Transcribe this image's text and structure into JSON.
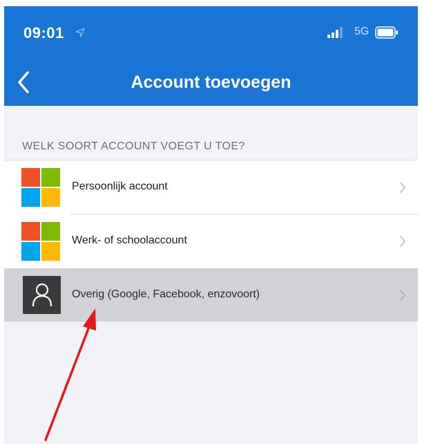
{
  "status_bar": {
    "time": "09:01",
    "network": "5G",
    "location_icon": "location-arrow-icon",
    "signal_icon": "signal-bars-icon",
    "battery_icon": "battery-icon"
  },
  "nav": {
    "title": "Account toevoegen",
    "back_icon": "chevron-left-icon"
  },
  "section_header": "WELK SOORT ACCOUNT VOEGT U TOE?",
  "accounts": [
    {
      "label": "Persoonlijk account",
      "icon": "microsoft-logo-icon",
      "selected": false
    },
    {
      "label": "Werk- of schoolaccount",
      "icon": "microsoft-logo-icon",
      "selected": false
    },
    {
      "label": "Overig (Google, Facebook, enzovoort)",
      "icon": "person-icon",
      "selected": true
    }
  ],
  "colors": {
    "brand_blue": "#1a74d6",
    "selected_row": "#d1d1d6",
    "background": "#f2f2f7",
    "annotation_arrow": "#e3191b",
    "ms_red": "#f25022",
    "ms_green": "#7fba00",
    "ms_blue": "#00a4ef",
    "ms_yellow": "#ffb900"
  },
  "annotation": {
    "type": "arrow",
    "points_to": "Overig (Google, Facebook, enzovoort)"
  }
}
